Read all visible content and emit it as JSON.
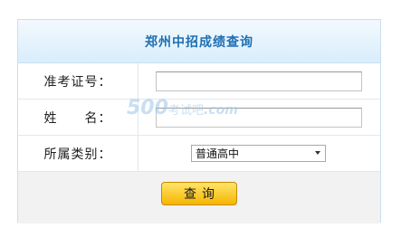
{
  "header": {
    "title": "郑州中招成绩查询"
  },
  "form": {
    "exam_number": {
      "label": "准考证号：",
      "value": ""
    },
    "name": {
      "label": "姓　　名：",
      "value": ""
    },
    "category": {
      "label": "所属类别：",
      "selected": "普通高中"
    }
  },
  "actions": {
    "submit_label": "查询"
  },
  "watermark": {
    "number": "500",
    "chinese": "考试吧",
    "domain": ".com"
  }
}
